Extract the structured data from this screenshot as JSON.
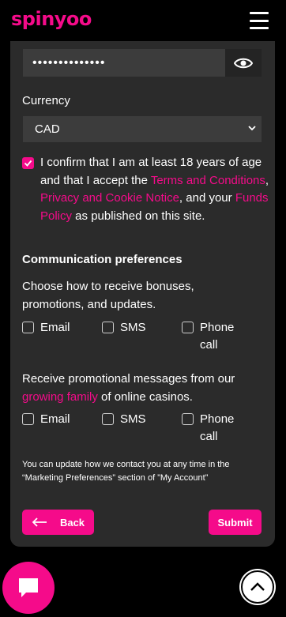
{
  "header": {
    "logo": "spinyoo"
  },
  "form": {
    "password_value": "••••••••••••••",
    "currency_label": "Currency",
    "currency_selected": "CAD",
    "confirm": {
      "t1": "I confirm that I am at least 18 years of age and that I accept the ",
      "terms": "Terms and Conditions",
      "t2": ", ",
      "privacy": "Privacy and Cookie Notice",
      "t3": ", and your ",
      "funds": "Funds Policy",
      "t4": " as published on this site."
    },
    "comm_heading": "Communication preferences",
    "comm_desc": "Choose how to receive bonuses, promotions, and updates.",
    "options": {
      "email": "Email",
      "sms": "SMS",
      "phone": "Phone call"
    },
    "promo": {
      "t1": "Receive promotional messages from our ",
      "link": "growing family",
      "t2": " of online casinos."
    },
    "footnote": "You can update how we contact you at any time in the “Marketing Preferences” section of ”My Account”",
    "back_label": "Back",
    "submit_label": "Submit"
  },
  "colors": {
    "accent": "#f50b8a",
    "panel": "#2b2b2b",
    "field": "#3c3c3c"
  },
  "icons": [
    "menu-icon",
    "eye-icon",
    "chevron-down-icon",
    "check-icon",
    "arrow-left-icon",
    "chat-icon",
    "chevron-up-icon"
  ]
}
